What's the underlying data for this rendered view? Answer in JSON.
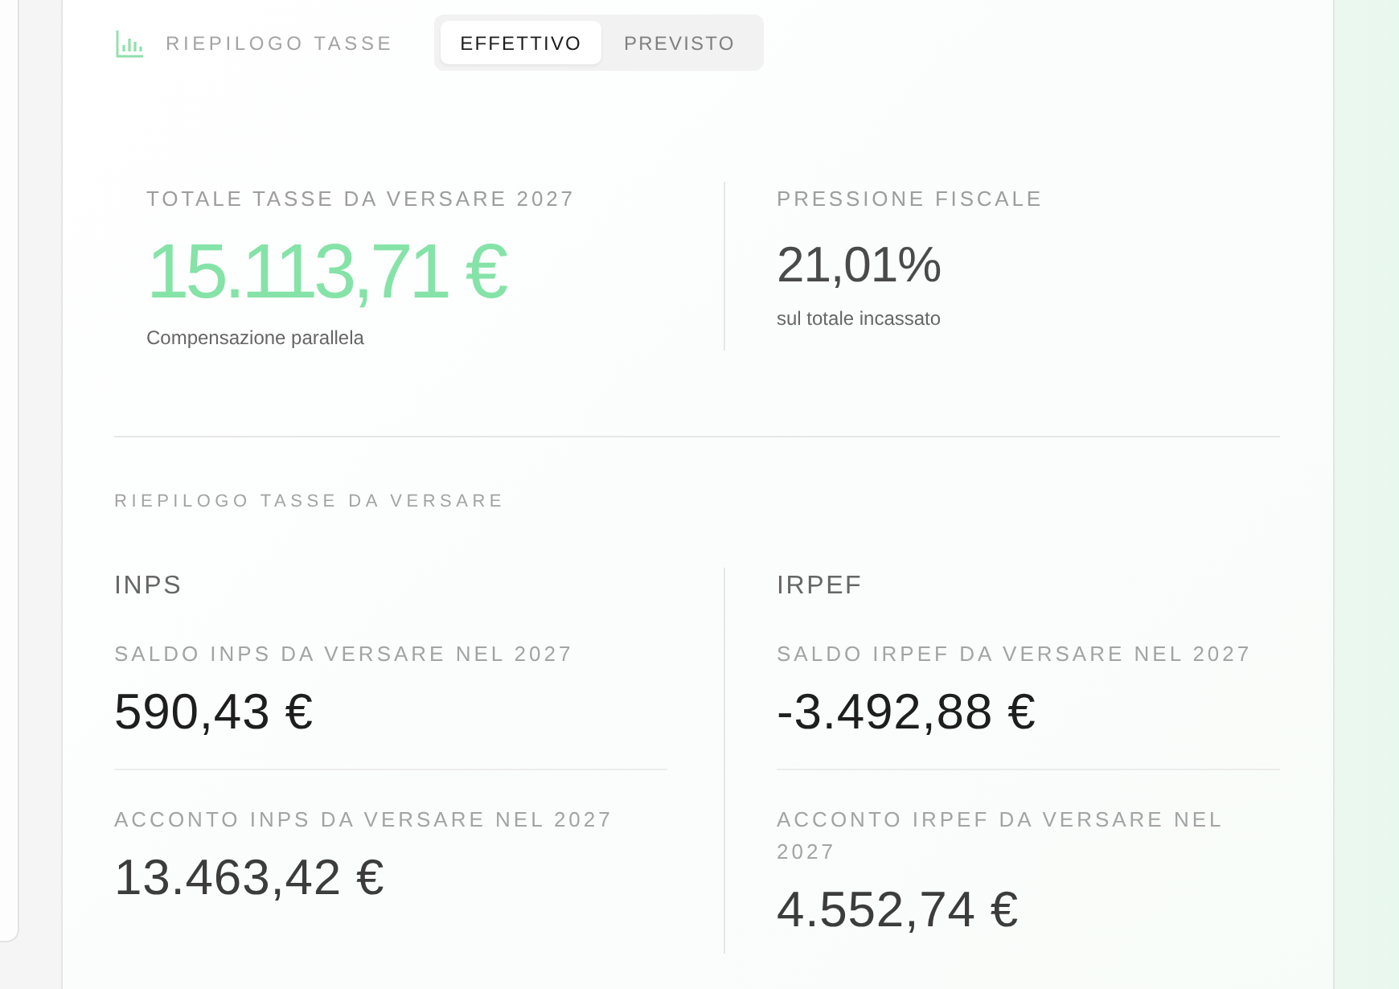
{
  "header": {
    "title": "RIEPILOGO TASSE",
    "tabs": [
      {
        "label": "EFFETTIVO",
        "selected": true
      },
      {
        "label": "PREVISTO",
        "selected": false
      }
    ]
  },
  "summary": [
    {
      "kind": "highlight",
      "label": "TOTALE TASSE DA VERSARE 2027",
      "value": "15.113,71 €",
      "note": "Compensazione parallela"
    },
    {
      "kind": "plain",
      "label": "PRESSIONE FISCALE",
      "value": "21,01%",
      "note": "sul totale incassato"
    }
  ],
  "breakdown": {
    "title": "RIEPILOGO TASSE DA VERSARE",
    "groups": [
      {
        "name": "INPS",
        "items": [
          {
            "label": "SALDO INPS DA VERSARE NEL 2027",
            "value": "590,43 €"
          },
          {
            "label": "ACCONTO INPS DA VERSARE NEL 2027",
            "value": "13.463,42 €"
          }
        ]
      },
      {
        "name": "IRPEF",
        "items": [
          {
            "label": "SALDO IRPEF DA VERSARE NEL 2027",
            "value": "-3.492,88 €"
          },
          {
            "label": "ACCONTO IRPEF DA VERSARE NEL 2027",
            "value": "4.552,74 €"
          }
        ]
      }
    ]
  }
}
